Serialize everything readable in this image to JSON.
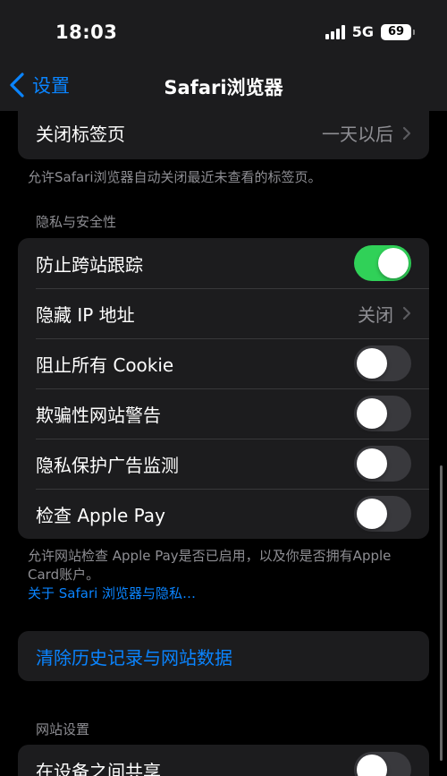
{
  "status": {
    "time": "18:03",
    "network": "5G",
    "battery": "69"
  },
  "nav": {
    "back_label": "设置",
    "title": "Safari浏览器"
  },
  "tabs_group": {
    "close_tabs_label": "关闭标签页",
    "close_tabs_value": "一天以后"
  },
  "tabs_footnote": "允许Safari浏览器自动关闭最近未查看的标签页。",
  "privacy": {
    "header": "隐私与安全性",
    "prevent_tracking_label": "防止跨站跟踪",
    "prevent_tracking_on": true,
    "hide_ip_label": "隐藏 IP 地址",
    "hide_ip_value": "关闭",
    "block_cookies_label": "阻止所有 Cookie",
    "block_cookies_on": false,
    "fraud_warning_label": "欺骗性网站警告",
    "fraud_warning_on": false,
    "ad_measurement_label": "隐私保护广告监测",
    "ad_measurement_on": false,
    "apple_pay_label": "检查 Apple Pay",
    "apple_pay_on": false
  },
  "privacy_footnote": {
    "text": "允许网站检查 Apple Pay是否已启用，以及你是否拥有Apple Card账户。",
    "link": "关于 Safari 浏览器与隐私…"
  },
  "clear_history_label": "清除历史记录与网站数据",
  "website_settings": {
    "header": "网站设置",
    "share_devices_label": "在设备之间共享",
    "share_devices_on": false
  }
}
